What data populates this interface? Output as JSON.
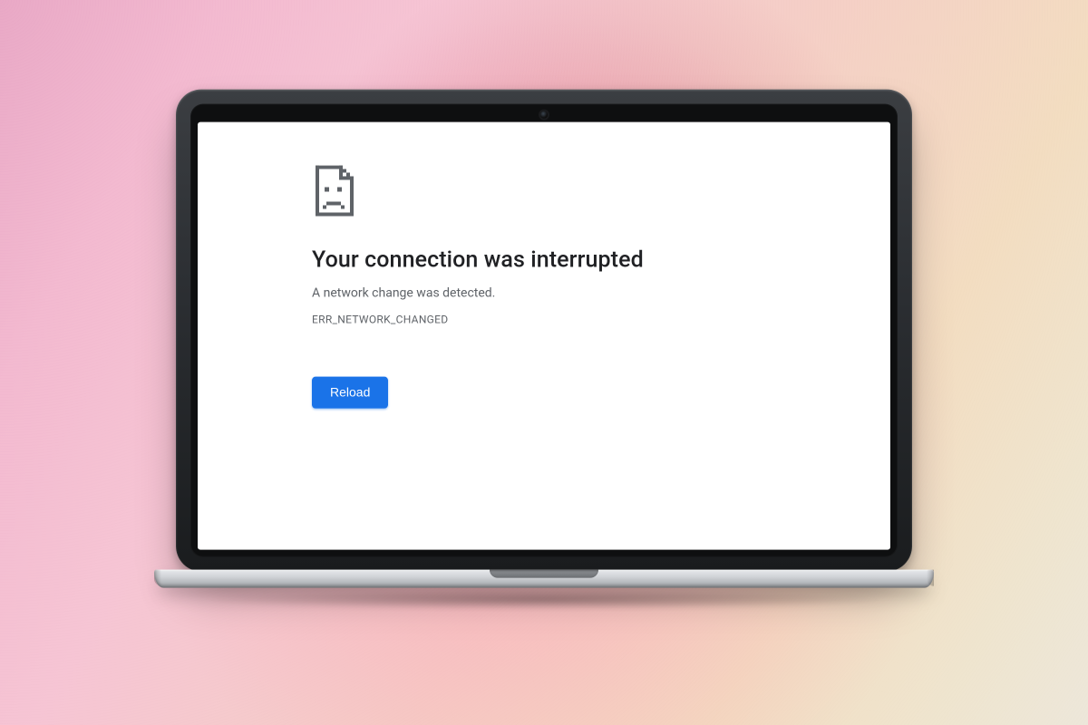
{
  "error": {
    "title": "Your connection was interrupted",
    "subtitle": "A network change was detected.",
    "code": "ERR_NETWORK_CHANGED",
    "reload_label": "Reload",
    "icon_name": "sad-document-icon"
  },
  "colors": {
    "primary_button": "#1a73e8",
    "text_primary": "#202124",
    "text_secondary": "#5f6368"
  }
}
